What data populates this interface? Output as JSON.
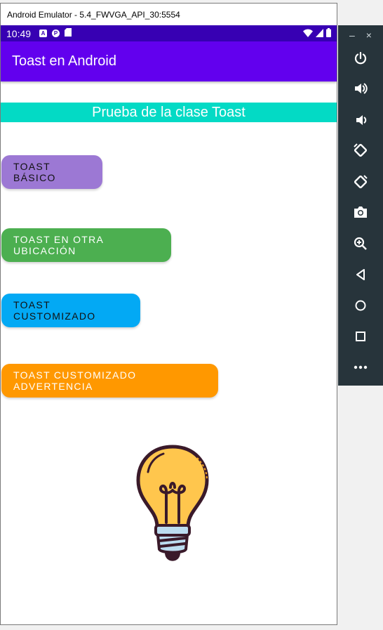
{
  "window": {
    "title": "Android Emulator - 5.4_FWVGA_API_30:5554"
  },
  "statusbar": {
    "time": "10:49",
    "icons": [
      "a-icon",
      "p-icon",
      "sd-card-icon"
    ]
  },
  "appbar": {
    "title": "Toast en Android"
  },
  "header": {
    "text": "Prueba de la clase Toast"
  },
  "buttons": {
    "basic": "TOAST BÁSICO",
    "ubicacion": "TOAST EN OTRA UBICACIÓN",
    "customizado": "TOAST CUSTOMIZADO",
    "advertencia": "TOAST CUSTOMIZADO ADVERTENCIA"
  },
  "toolbar": {
    "minimize": "–",
    "close": "×"
  },
  "colors": {
    "statusbar": "#3700b3",
    "appbar": "#6200ee",
    "header": "#03dac5",
    "basic": "#9c78d4",
    "ubicacion": "#4caf50",
    "customizado": "#03a9f4",
    "advertencia": "#ff9800"
  }
}
